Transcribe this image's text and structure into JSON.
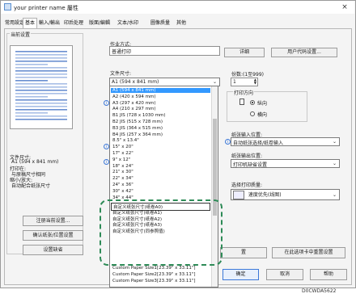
{
  "window": {
    "title": "your printer name 屬性",
    "close_label": "×",
    "tabs": [
      "常用設定",
      "基本",
      "輸入/輸出",
      "印后处理",
      "版面/編輯",
      "文本/水印",
      "圖像质量",
      "其他"
    ]
  },
  "left_panel": {
    "current_settings_label": "当前设置",
    "summary": {
      "paper_size_label": "文件尺寸:",
      "paper_size_value": "A1 (594 x 841 mm)",
      "print_on_label": "打印在:",
      "print_on_value": "与原稿尺寸相同",
      "scale_label": "缩小/放大:",
      "scale_value": "自动配合纸张尺寸"
    },
    "buttons": {
      "register": "注册当前设置...",
      "confirm": "确认纸张/位置设置",
      "reset": "设置缺省"
    }
  },
  "job": {
    "type_label": "作业方式:",
    "type_value": "普通打印",
    "details_button": "详细",
    "user_code_button": "用户代码设置..."
  },
  "document_size": {
    "label": "文件尺寸:",
    "value": "A1 (594 x 841 mm)",
    "options": [
      "A1 (594 x 841 mm)",
      "A2 (420 x 594 mm)",
      "A3 (297 x 420 mm)",
      "A4 (210 x 297 mm)",
      "B1 JIS (728 x 1030 mm)",
      "B2 JIS (515 x 728 mm)",
      "B3 JIS (364 x 515 mm)",
      "B4 JIS (257 x 364 mm)",
      "8.5\" x 13.4\"",
      "15\" x 20\"",
      "17\" x 22\"",
      "9\" x 12\"",
      "18\" x 24\"",
      "21\" x 30\"",
      "22\" x 34\"",
      "24\" x 36\"",
      "30\" x 42\"",
      "34\" x 44\""
    ],
    "custom_options": [
      "自定义纸张尺寸(纸卷A0)",
      "自定义纸张尺寸(纸卷A1)",
      "自定义纸张尺寸(纸卷A2)",
      "自定义纸张尺寸(纸卷A3)",
      "自定义纸张尺寸(同参照值)"
    ],
    "trailing_options": [
      "Custom Paper Size1[23.39\" x 33.11\"]",
      "Custom Paper Size2[23.39\" x 33.11\"]",
      "Custom Paper Size3[23.39\" x 33.11\"]"
    ],
    "selected_index": 0
  },
  "copies": {
    "label": "份数:(1至999)",
    "value": "1"
  },
  "orientation": {
    "label": "打印方向",
    "portrait": "纵向",
    "landscape": "横向",
    "selected": "portrait"
  },
  "input_tray": {
    "label": "纸张输入位置:",
    "value": "自动纸张选择/纸卷输入"
  },
  "output_tray": {
    "label": "纸张输出位置:",
    "value": "打印机缺省设置"
  },
  "print_quality": {
    "label": "选择打印质量:",
    "value": "速度优先(线图)"
  },
  "bottom": {
    "left_button": "置",
    "wide_button": "在此选项卡中重置设置",
    "ok": "确定",
    "cancel": "取消",
    "help": "帮助"
  },
  "figure_code": "D0CWDA5622"
}
